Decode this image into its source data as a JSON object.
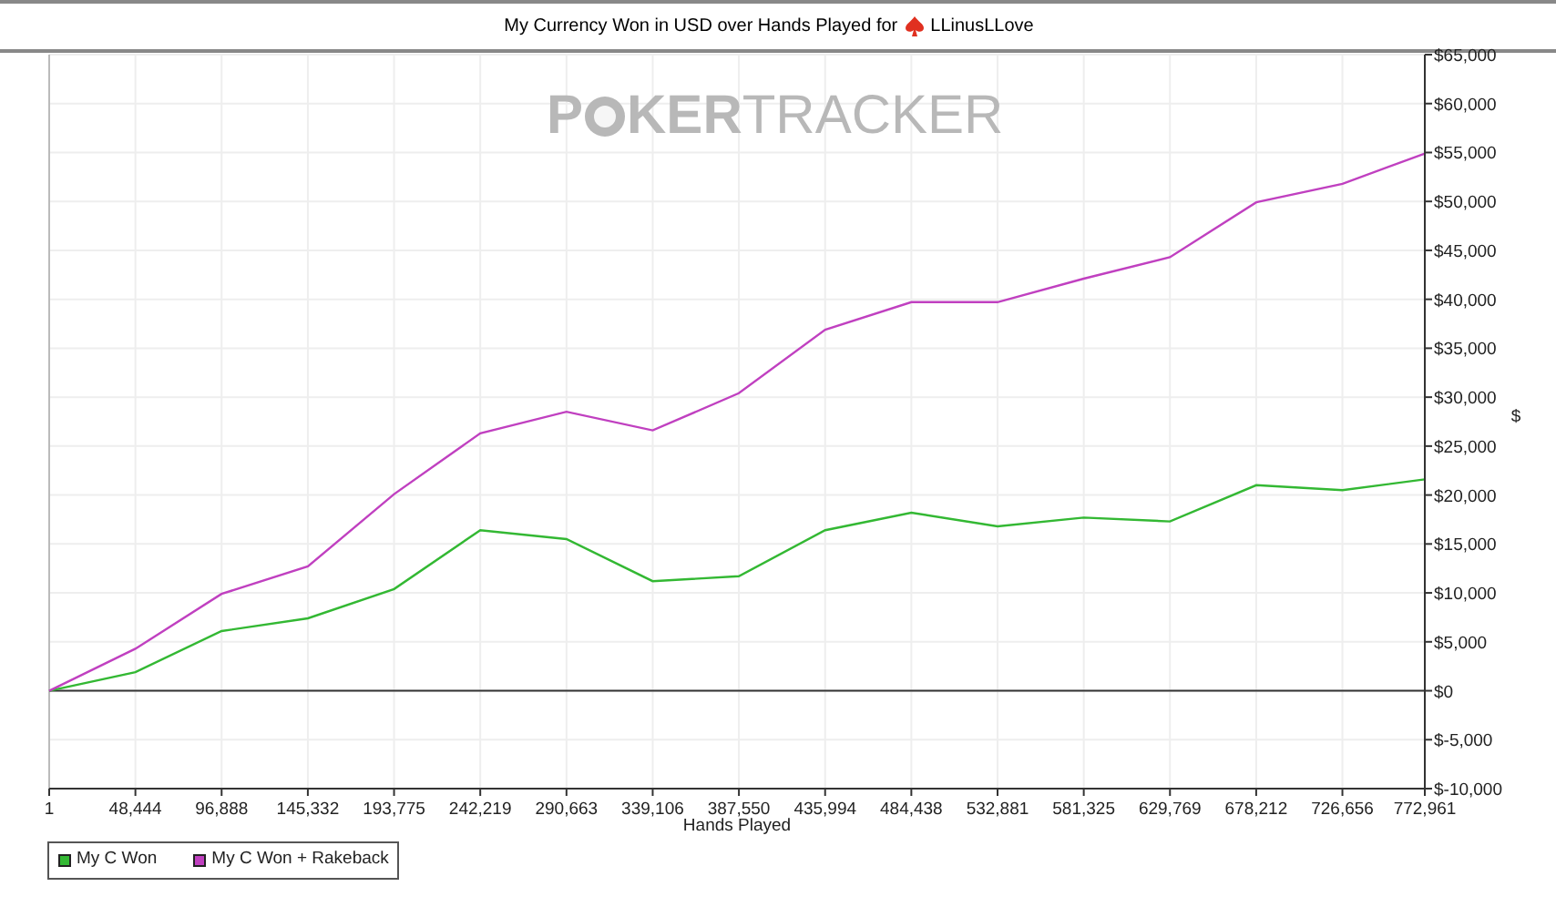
{
  "title": {
    "text": "My Currency Won in USD over Hands Played for",
    "player": "LLinusLLove"
  },
  "watermark": {
    "part_1": "P",
    "part_2": "KER",
    "part_3": "TRACKER"
  },
  "chart_data": {
    "type": "line",
    "grid": true,
    "xlabel": "Hands Played",
    "ylabel": "$",
    "x": [
      1,
      48444,
      96888,
      145332,
      193775,
      242219,
      290663,
      339106,
      387550,
      435994,
      484438,
      532881,
      581325,
      629769,
      678212,
      726656,
      772961
    ],
    "series": [
      {
        "name": "My C Won",
        "color": "#33b833",
        "values": [
          0,
          1900,
          6100,
          7400,
          10400,
          16400,
          15500,
          11200,
          11700,
          16400,
          18200,
          16800,
          17700,
          17300,
          21000,
          20500,
          21600
        ]
      },
      {
        "name": "My C Won + Rakeback",
        "color": "#c040c0",
        "values": [
          0,
          4300,
          9900,
          12700,
          20100,
          26300,
          28500,
          26600,
          30400,
          36900,
          39700,
          39700,
          42100,
          44300,
          49900,
          51800,
          54900
        ]
      }
    ],
    "xlim": [
      1,
      772961
    ],
    "ylim": [
      -10000,
      65000
    ],
    "xticks": [
      {
        "value": 1,
        "label": "1"
      },
      {
        "value": 48444,
        "label": "48,444"
      },
      {
        "value": 96888,
        "label": "96,888"
      },
      {
        "value": 145332,
        "label": "145,332"
      },
      {
        "value": 193775,
        "label": "193,775"
      },
      {
        "value": 242219,
        "label": "242,219"
      },
      {
        "value": 290663,
        "label": "290,663"
      },
      {
        "value": 339106,
        "label": "339,106"
      },
      {
        "value": 387550,
        "label": "387,550"
      },
      {
        "value": 435994,
        "label": "435,994"
      },
      {
        "value": 484438,
        "label": "484,438"
      },
      {
        "value": 532881,
        "label": "532,881"
      },
      {
        "value": 581325,
        "label": "581,325"
      },
      {
        "value": 629769,
        "label": "629,769"
      },
      {
        "value": 678212,
        "label": "678,212"
      },
      {
        "value": 726656,
        "label": "726,656"
      },
      {
        "value": 772961,
        "label": "772,961"
      }
    ],
    "yticks": [
      {
        "value": 65000,
        "label": "$65,000"
      },
      {
        "value": 60000,
        "label": "$60,000"
      },
      {
        "value": 55000,
        "label": "$55,000"
      },
      {
        "value": 50000,
        "label": "$50,000"
      },
      {
        "value": 45000,
        "label": "$45,000"
      },
      {
        "value": 40000,
        "label": "$40,000"
      },
      {
        "value": 35000,
        "label": "$35,000"
      },
      {
        "value": 30000,
        "label": "$30,000"
      },
      {
        "value": 25000,
        "label": "$25,000"
      },
      {
        "value": 20000,
        "label": "$20,000"
      },
      {
        "value": 15000,
        "label": "$15,000"
      },
      {
        "value": 10000,
        "label": "$10,000"
      },
      {
        "value": 5000,
        "label": "$5,000"
      },
      {
        "value": 0,
        "label": "$0"
      },
      {
        "value": -5000,
        "label": "$-5,000"
      },
      {
        "value": -10000,
        "label": "$-10,000"
      }
    ]
  }
}
